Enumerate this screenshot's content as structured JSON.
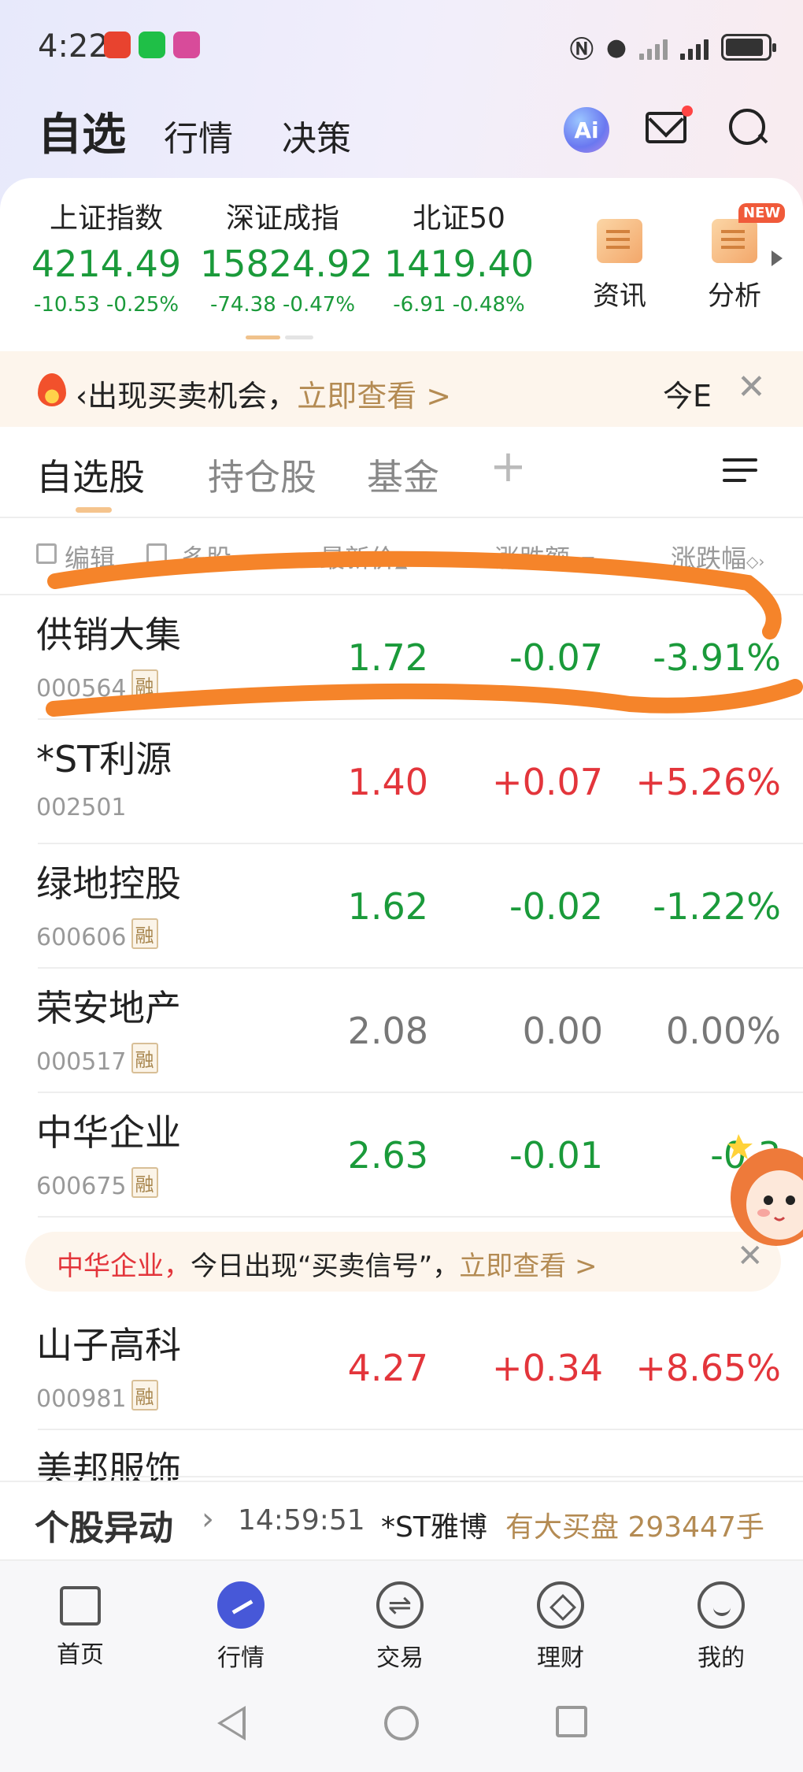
{
  "status_bar": {
    "time": "4:22"
  },
  "header": {
    "tabs": [
      "自选",
      "行情",
      "决策"
    ],
    "ai_label": "Ai"
  },
  "indices": [
    {
      "name": "上证指数",
      "value": "4214.49",
      "change": "-10.53",
      "pct": "-0.25%"
    },
    {
      "name": "深证成指",
      "value": "15824.92",
      "change": "-74.38",
      "pct": "-0.47%"
    },
    {
      "name": "北证50",
      "value": "1419.40",
      "change": "-6.91",
      "pct": "-0.48%"
    }
  ],
  "quick_links": [
    {
      "label": "资讯",
      "icon": "news-icon"
    },
    {
      "label": "分析",
      "icon": "analysis-icon",
      "badge": "NEW"
    }
  ],
  "alert": {
    "text": "‹出现买卖机会，",
    "link": "立即查看 >",
    "right_text": "今E",
    "close": "✕"
  },
  "subtabs": [
    "自选股",
    "持仓股",
    "基金",
    "+"
  ],
  "table_header": {
    "edit": "编辑",
    "multi": "多股",
    "price": "最新价",
    "change": "涨跌额",
    "pct": "涨跌幅"
  },
  "stocks": [
    {
      "name": "供销大集",
      "code": "000564",
      "rong": "融",
      "price": "1.72",
      "change": "-0.07",
      "pct": "-3.91%",
      "trend": "down"
    },
    {
      "name": "*ST利源",
      "code": "002501",
      "rong": "",
      "price": "1.40",
      "change": "+0.07",
      "pct": "+5.26%",
      "trend": "up"
    },
    {
      "name": "绿地控股",
      "code": "600606",
      "rong": "融",
      "price": "1.62",
      "change": "-0.02",
      "pct": "-1.22%",
      "trend": "down"
    },
    {
      "name": "荣安地产",
      "code": "000517",
      "rong": "融",
      "price": "2.08",
      "change": "0.00",
      "pct": "0.00%",
      "trend": "flat"
    },
    {
      "name": "中华企业",
      "code": "600675",
      "rong": "融",
      "price": "2.63",
      "change": "-0.01",
      "pct": "-0.3",
      "trend": "down"
    }
  ],
  "inline_ad": {
    "stock": "中华企业，",
    "text": "今日出现“买卖信号”，",
    "link": "立即查看 >",
    "close": "✕"
  },
  "stocks_more": [
    {
      "name": "山子高科",
      "code": "000981",
      "rong": "融",
      "price": "4.27",
      "change": "+0.34",
      "pct": "+8.65%",
      "trend": "up"
    },
    {
      "name": "美邦服饰",
      "code": "",
      "rong": "",
      "price": "",
      "change": "",
      "pct": "",
      "trend": "up"
    }
  ],
  "ticker": {
    "logo": "个股异动",
    "arrow": "›",
    "time": "14:59:51",
    "stock": "*ST雅博",
    "message": "有大买盘 293447手"
  },
  "bottom_nav": [
    {
      "label": "首页",
      "icon": "home-icon"
    },
    {
      "label": "行情",
      "icon": "market-icon",
      "active": true
    },
    {
      "label": "交易",
      "icon": "trade-icon"
    },
    {
      "label": "理财",
      "icon": "wealth-icon"
    },
    {
      "label": "我的",
      "icon": "profile-icon"
    }
  ],
  "colors": {
    "up": "#e3353b",
    "down": "#1a9a3a",
    "accent": "#b48b53",
    "annotation": "#f5842a"
  }
}
